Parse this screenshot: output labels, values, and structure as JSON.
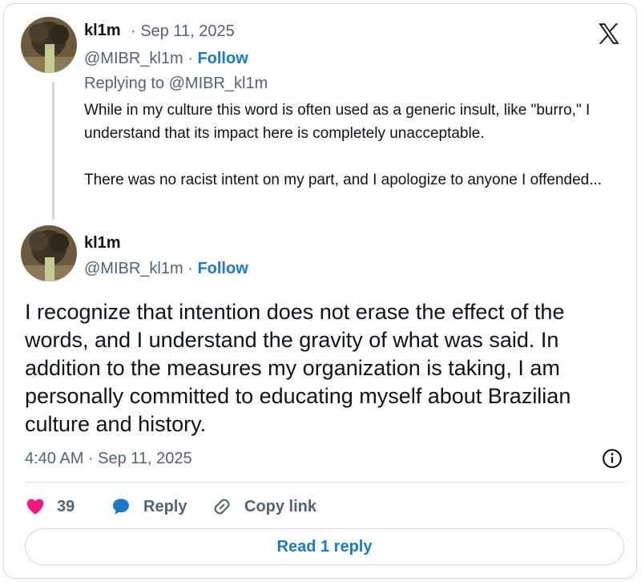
{
  "parent_tweet": {
    "display_name": "kl1m",
    "date": "· Sep 11, 2025",
    "handle": "@MIBR_kl1m",
    "separator": " · ",
    "follow_label": "Follow",
    "replying_to": "Replying to @MIBR_kl1m",
    "paragraphs": [
      "While in my culture this word is often used as a generic insult, like \"burro,\" I understand that its impact here is completely unacceptable.",
      "There was no racist intent on my part, and I apologize to anyone I offended..."
    ],
    "avatar_icon": "avatar-photo"
  },
  "main_tweet": {
    "display_name": "kl1m",
    "handle": "@MIBR_kl1m",
    "separator": " · ",
    "follow_label": "Follow",
    "text": "I recognize that intention does not erase the effect of the words, and I understand the gravity of what was said. In addition to the measures my organization is taking, I am personally committed to educating myself about Brazilian culture and history.",
    "timestamp": "4:40 AM · Sep 11, 2025",
    "avatar_icon": "avatar-photo"
  },
  "actions": {
    "like_count": "39",
    "reply_label": "Reply",
    "copy_link_label": "Copy link"
  },
  "read_replies_label": "Read 1 reply",
  "icons": {
    "brand": "x-logo-icon",
    "info": "info-icon",
    "like": "heart-icon",
    "reply": "comment-bubble-icon",
    "link": "link-icon"
  },
  "colors": {
    "accent": "#1d79c4",
    "like": "#f91880",
    "muted": "#536471",
    "border": "#cfd9de"
  }
}
